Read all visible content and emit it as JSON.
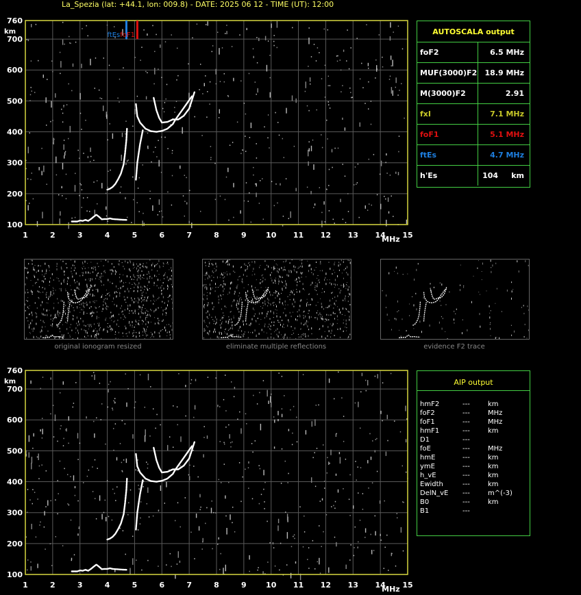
{
  "header": {
    "title": "La_Spezia (lat: +44.1, lon: 009.8) - DATE: 2025 06 12 - TIME (UT): 12:00"
  },
  "colors": {
    "grid": "#5a5a5a",
    "axis": "#d8d840",
    "trace": "#ffffff",
    "noise": "#aaaaaa",
    "panel_border": "#44d044",
    "accent_yellow": "#ffff33",
    "foF1_red": "#e01010",
    "ftEs_blue": "#1e7fe0",
    "fxI_yellow": "#c8c828"
  },
  "autoscala": {
    "title": "AUTOSCALA output",
    "rows": [
      {
        "key": "foF2",
        "value": "6.5 MHz",
        "color": "#ffffff"
      },
      {
        "key": "MUF(3000)F2",
        "value": "18.9 MHz",
        "color": "#ffffff"
      },
      {
        "key": "M(3000)F2",
        "value": "2.91",
        "color": "#ffffff"
      },
      {
        "key": "fxI",
        "value": "7.1 MHz",
        "color": "#c8c828"
      },
      {
        "key": "foF1",
        "value": "5.1 MHz",
        "color": "#e01010"
      },
      {
        "key": "ftEs",
        "value": "4.7 MHz",
        "color": "#1e7fe0"
      },
      {
        "key": "h'Es",
        "value": "104     km",
        "color": "#ffffff"
      }
    ]
  },
  "aip": {
    "title": "AIP output",
    "rows": [
      {
        "key": "hmF2",
        "value": "---",
        "unit": "km"
      },
      {
        "key": "foF2",
        "value": "---",
        "unit": "MHz"
      },
      {
        "key": "foF1",
        "value": "---",
        "unit": "MHz"
      },
      {
        "key": "hmF1",
        "value": "---",
        "unit": "km"
      },
      {
        "key": "D1",
        "value": "---",
        "unit": ""
      },
      {
        "key": "foE",
        "value": "---",
        "unit": "MHz"
      },
      {
        "key": "hmE",
        "value": "---",
        "unit": "km"
      },
      {
        "key": "ymE",
        "value": "---",
        "unit": "km"
      },
      {
        "key": "h_vE",
        "value": "---",
        "unit": "km"
      },
      {
        "key": "Ewidth",
        "value": "---",
        "unit": "km"
      },
      {
        "key": "DelN_vE",
        "value": "---",
        "unit": "m^(-3)"
      },
      {
        "key": "B0",
        "value": "---",
        "unit": "km"
      },
      {
        "key": "B1",
        "value": "---",
        "unit": ""
      }
    ]
  },
  "thumbnails": [
    {
      "caption": "original ionogram resized"
    },
    {
      "caption": "eliminate multiple reflections"
    },
    {
      "caption": "evidence F2 trace"
    }
  ],
  "chart_data": [
    {
      "type": "scatter",
      "title": "",
      "xlabel": "MHz",
      "ylabel": "km",
      "xlim": [
        1,
        15
      ],
      "ylim": [
        100,
        760
      ],
      "x_ticks": [
        1,
        2,
        3,
        4,
        5,
        6,
        7,
        8,
        9,
        10,
        11,
        12,
        13,
        14,
        15
      ],
      "y_ticks": [
        100,
        200,
        300,
        400,
        500,
        600,
        700,
        760
      ],
      "grid": true,
      "markers": [
        {
          "label": "ftEs",
          "x": 4.7,
          "color": "#1e7fe0"
        },
        {
          "label": "foF1",
          "x": 5.1,
          "color": "#e01010"
        }
      ],
      "series": [
        {
          "name": "",
          "kind": "E-trace",
          "x": [
            2.7,
            2.9,
            3.0,
            3.1,
            3.2,
            3.3,
            3.4,
            3.5,
            3.6,
            3.7,
            3.8,
            3.9,
            4.0,
            4.1,
            4.2,
            4.5,
            4.7
          ],
          "y": [
            110,
            110,
            113,
            112,
            115,
            112,
            118,
            125,
            132,
            125,
            117,
            118,
            118,
            120,
            118,
            116,
            115
          ]
        },
        {
          "name": "",
          "kind": "F1-trace",
          "x": [
            4.0,
            4.1,
            4.2,
            4.3,
            4.4,
            4.5,
            4.6,
            4.65,
            4.7,
            4.72
          ],
          "y": [
            213,
            216,
            222,
            232,
            247,
            265,
            295,
            330,
            375,
            410
          ]
        },
        {
          "name": "",
          "kind": "F2-o-trace",
          "x": [
            5.05,
            5.1,
            5.2,
            5.4,
            5.6,
            5.8,
            6.0,
            6.2,
            6.4,
            6.5,
            6.7,
            6.9,
            7.1
          ],
          "y": [
            490,
            450,
            430,
            410,
            402,
            400,
            403,
            410,
            425,
            440,
            465,
            490,
            515
          ]
        },
        {
          "name": "",
          "kind": "F2-x-trace",
          "x": [
            5.05,
            5.1,
            5.2,
            5.3
          ],
          "y": [
            245,
            300,
            360,
            405
          ]
        },
        {
          "name": "",
          "kind": "F2-cusp",
          "x": [
            5.7,
            5.8,
            5.9,
            6.0,
            6.2,
            6.4,
            6.6,
            6.8,
            7.0,
            7.2
          ],
          "y": [
            510,
            470,
            445,
            430,
            432,
            440,
            440,
            452,
            475,
            530
          ]
        }
      ]
    },
    {
      "type": "scatter",
      "title": "",
      "xlabel": "MHz",
      "ylabel": "km",
      "xlim": [
        1,
        15
      ],
      "ylim": [
        100,
        760
      ],
      "x_ticks": [
        1,
        2,
        3,
        4,
        5,
        6,
        7,
        8,
        9,
        10,
        11,
        12,
        13,
        14,
        15
      ],
      "y_ticks": [
        100,
        200,
        300,
        400,
        500,
        600,
        700,
        760
      ],
      "grid": true,
      "series": [
        {
          "name": "",
          "kind": "E-trace",
          "x": [
            2.7,
            2.9,
            3.0,
            3.1,
            3.2,
            3.3,
            3.4,
            3.5,
            3.6,
            3.7,
            3.8,
            3.9,
            4.0,
            4.1,
            4.2,
            4.5,
            4.7
          ],
          "y": [
            110,
            110,
            113,
            112,
            115,
            112,
            118,
            125,
            132,
            125,
            117,
            118,
            118,
            120,
            118,
            116,
            115
          ]
        },
        {
          "name": "",
          "kind": "F1-trace",
          "x": [
            4.0,
            4.1,
            4.2,
            4.3,
            4.4,
            4.5,
            4.6,
            4.65,
            4.7,
            4.72
          ],
          "y": [
            213,
            216,
            222,
            232,
            247,
            265,
            295,
            330,
            375,
            410
          ]
        },
        {
          "name": "",
          "kind": "F2-o-trace",
          "x": [
            5.05,
            5.1,
            5.2,
            5.4,
            5.6,
            5.8,
            6.0,
            6.2,
            6.4,
            6.5,
            6.7,
            6.9,
            7.1
          ],
          "y": [
            490,
            450,
            430,
            410,
            402,
            400,
            403,
            410,
            425,
            440,
            465,
            490,
            515
          ]
        },
        {
          "name": "",
          "kind": "F2-x-trace",
          "x": [
            5.05,
            5.1,
            5.2,
            5.3
          ],
          "y": [
            245,
            300,
            360,
            405
          ]
        },
        {
          "name": "",
          "kind": "F2-cusp",
          "x": [
            5.7,
            5.8,
            5.9,
            6.0,
            6.2,
            6.4,
            6.6,
            6.8,
            7.0,
            7.2
          ],
          "y": [
            510,
            470,
            445,
            430,
            432,
            440,
            440,
            452,
            475,
            530
          ]
        }
      ]
    }
  ]
}
